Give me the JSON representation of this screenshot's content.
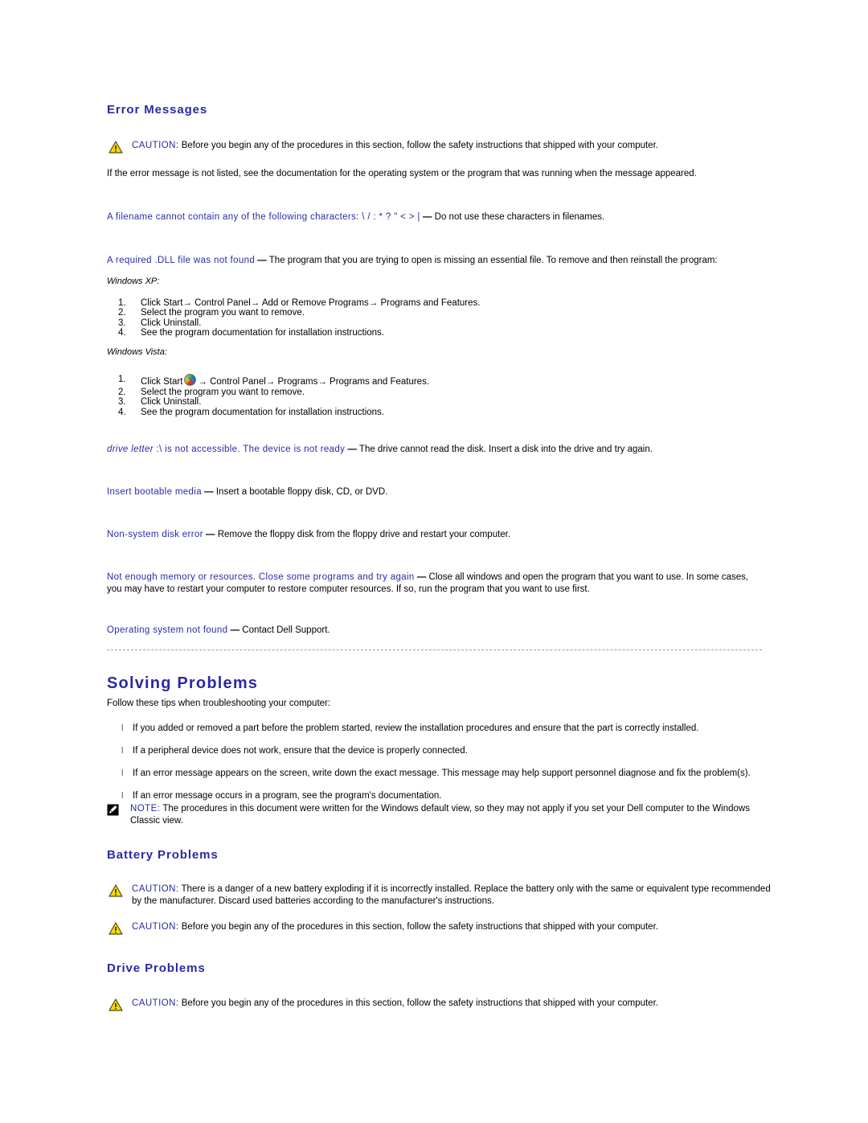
{
  "document": {
    "sections": [
      {
        "id": "error-messages",
        "heading": "Error Messages"
      },
      {
        "id": "solving-problems",
        "heading": "Solving Problems"
      },
      {
        "id": "battery-problems",
        "heading": "Battery Problems"
      },
      {
        "id": "drive-problems",
        "heading": "Drive Problems"
      }
    ]
  },
  "error_messages": {
    "heading": "Error Messages",
    "caution": {
      "icon": "caution-triangle-icon",
      "label": "CAUTION:",
      "text": " Before you begin any of the procedures in this section, follow the safety instructions that shipped with your computer."
    },
    "intro": "If the error message is not listed, see the documentation for the operating system or the program that was running when the message appeared.",
    "messages": [
      {
        "term": "A filename cannot contain any of the following characters: \\ / : * ? \" < > |",
        "dash": "—",
        "body": " Do not use these characters in filenames."
      },
      {
        "term": "A required .DLL file was not found",
        "dash": "—",
        "body": " The program that you are trying to open is missing an essential file. To remove and then reinstall the program:"
      }
    ],
    "dll_procedures": [
      {
        "os": "Windows XP:",
        "has_orb": false,
        "steps": [
          "Click Start→ Control Panel→ Add or Remove Programs→ Programs and Features.",
          "Select the program you want to remove.",
          "Click Uninstall.",
          "See the program documentation for installation instructions."
        ]
      },
      {
        "os": "Windows Vista:",
        "has_orb": true,
        "orb_icon": "windows-vista-start-orb-icon",
        "step1_prefix": "Click Start",
        "step1_suffix": "→ Control Panel→ Programs→ Programs and Features.",
        "steps": [
          "",
          "Select the program you want to remove.",
          "Click Uninstall.",
          "See the program documentation for installation instructions."
        ]
      }
    ],
    "messages_2": [
      {
        "term_italic": "drive letter",
        "term": " :\\ is not accessible. The device is not ready",
        "dash": "—",
        "body": " The drive cannot read the disk. Insert a disk into the drive and try again."
      },
      {
        "term": "Insert bootable media",
        "dash": "—",
        "body": " Insert a bootable floppy disk, CD, or DVD."
      },
      {
        "term": "Non-system disk error",
        "dash": "—",
        "body": " Remove the floppy disk from the floppy drive and restart your computer."
      },
      {
        "term": "Not enough memory or resources. Close some programs and try again",
        "dash": "—",
        "body": " Close all windows and open the program that you want to use. In some cases, you may have to restart your computer to restore computer resources. If so, run the program that you want to use first."
      },
      {
        "term": "Operating system not found",
        "dash": "—",
        "body": " Contact Dell Support."
      }
    ]
  },
  "solving_problems": {
    "heading": "Solving Problems",
    "intro": "Follow these tips when troubleshooting your computer:",
    "bullet_glyph": "l",
    "tips": [
      "If you added or removed a part before the problem started, review the installation procedures and ensure that the part is correctly installed.",
      "If a peripheral device does not work, ensure that the device is properly connected.",
      "If an error message appears on the screen, write down the exact message. This message may help support personnel diagnose and fix the problem(s).",
      "If an error message occurs in a program, see the program's documentation."
    ],
    "note": {
      "icon": "note-pencil-icon",
      "label": "NOTE:",
      "text": " The procedures in this document were written for the Windows default view, so they may not apply if you set your Dell computer to the Windows Classic view."
    }
  },
  "battery_problems": {
    "heading": "Battery Problems",
    "cautions": [
      {
        "icon": "caution-triangle-icon",
        "label": "CAUTION:",
        "text": " There is a danger of a new battery exploding if it is incorrectly installed. Replace the battery only with the same or equivalent type recommended by the manufacturer. Discard used batteries according to the manufacturer's instructions."
      },
      {
        "icon": "caution-triangle-icon",
        "label": "CAUTION:",
        "text": " Before you begin any of the procedures in this section, follow the safety instructions that shipped with your computer."
      }
    ]
  },
  "drive_problems": {
    "heading": "Drive Problems",
    "cautions": [
      {
        "icon": "caution-triangle-icon",
        "label": "CAUTION:",
        "text": " Before you begin any of the procedures in this section, follow the safety instructions that shipped with your computer."
      }
    ]
  },
  "colors": {
    "heading_blue": "#2a2aa5",
    "term_blue": "#2a2aa5",
    "body_black": "#000000",
    "caution_yellow": "#ffd800",
    "rule_gray": "#9a9a9a"
  }
}
